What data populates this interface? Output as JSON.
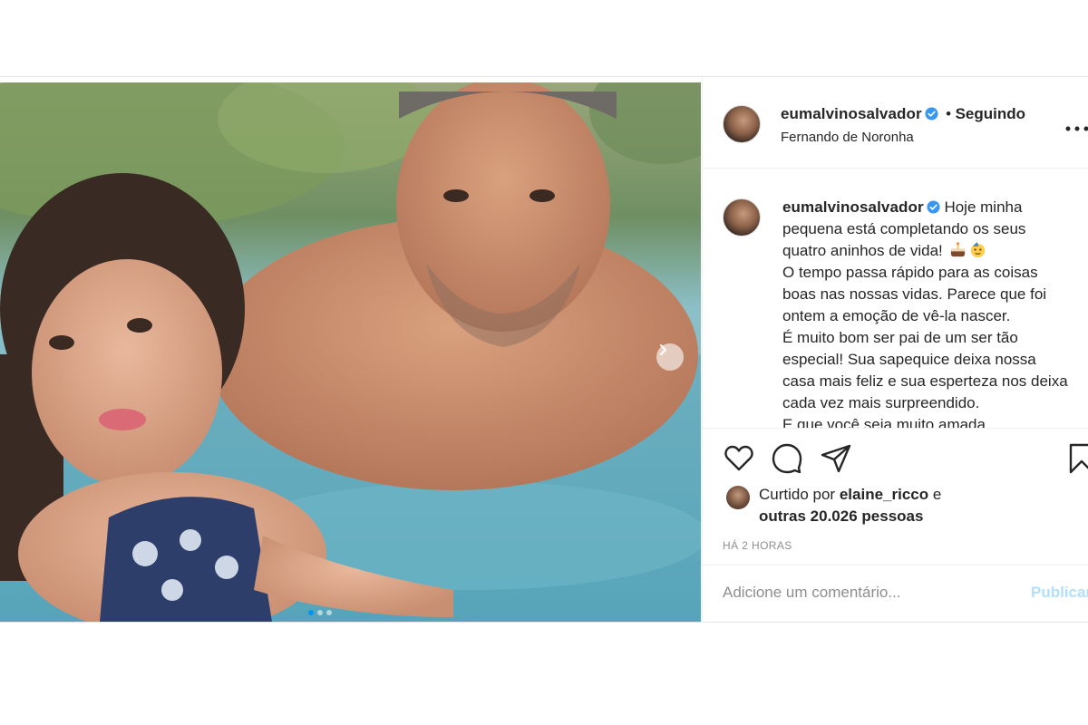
{
  "post": {
    "username": "eumalvinosalvador",
    "follow_separator": "•",
    "follow_status": "Seguindo",
    "location": "Fernando de Noronha",
    "more_icon": "more-horizontal-icon",
    "verified_color": "#3897f0"
  },
  "caption": {
    "username": "eumalvinosalvador",
    "text_1": "Hoje minha pequena está completando os seus quatro aninhos de vida!",
    "emojis": [
      "cake-emoji",
      "party-face-emoji"
    ],
    "text_2": "O tempo passa rápido para as coisas boas nas nossas vidas. Parece que foi ontem a emoção de vê-la nascer.",
    "text_3": "É muito bom ser pai de um ser tão especial! Sua sapequice deixa nossa casa mais feliz e sua esperteza nos deixa cada vez mais surpreendido.",
    "text_4": "E que você seja muito amada"
  },
  "actions": {
    "like_icon": "heart-icon",
    "comment_icon": "comment-icon",
    "share_icon": "share-icon",
    "save_icon": "bookmark-icon"
  },
  "likes": {
    "prefix": "Curtido por",
    "liker": "elaine_ricco",
    "conjunction": "e",
    "others": "outras 20.026 pessoas"
  },
  "timestamp": "HÁ 2 HORAS",
  "comment": {
    "placeholder": "Adicione um comentário...",
    "publish_label": "Publicar"
  },
  "colors": {
    "accent": "#0095f6",
    "publish_disabled": "#b2dffc",
    "secondary_text": "#8e8e8e"
  }
}
